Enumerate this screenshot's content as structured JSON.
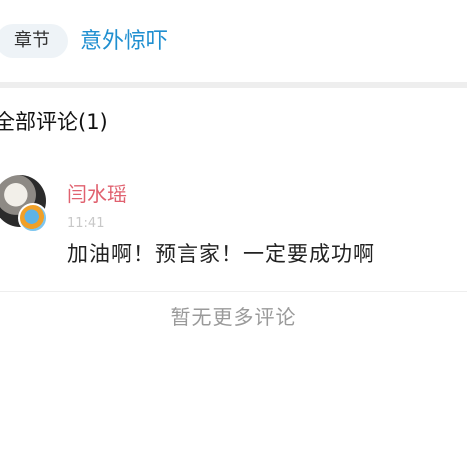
{
  "chapter": {
    "pill_label": "章节",
    "title": "意外惊吓"
  },
  "comments_section": {
    "header_label": "全部评论",
    "count_text": "(1)"
  },
  "comments": [
    {
      "username": "闫水瑶",
      "time": "11:41",
      "text": "加油啊！预言家！一定要成功啊"
    }
  ],
  "footer": {
    "no_more_text": "暂无更多评论"
  },
  "colors": {
    "chapter_title": "#1f8fd0",
    "username": "#e0616f",
    "muted": "#9a9a9a"
  }
}
